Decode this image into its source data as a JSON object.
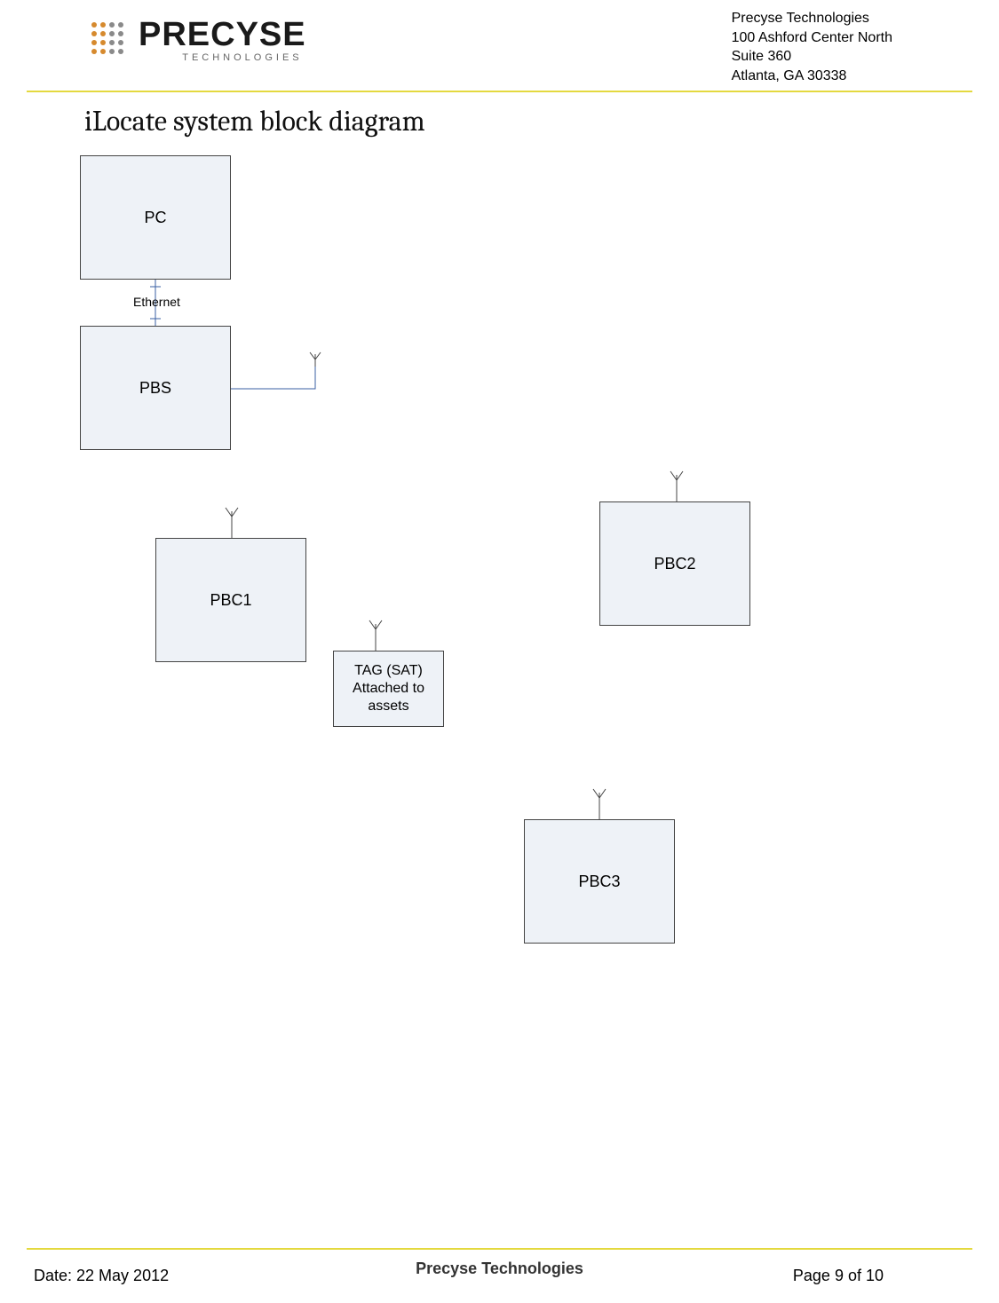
{
  "header": {
    "logo_main": "PRECYSE",
    "logo_sub": "TECHNOLOGIES",
    "address_line1": "Precyse Technologies",
    "address_line2": "100 Ashford Center North",
    "address_line3": "Suite 360",
    "address_line4": "Atlanta, GA  30338"
  },
  "title": "iLocate system block diagram",
  "diagram": {
    "blocks": {
      "pc": "PC",
      "pbs": "PBS",
      "pbc1": "PBC1",
      "pbc2": "PBC2",
      "pbc3": "PBC3",
      "tag": "TAG (SAT)\nAttached to\nassets"
    },
    "connectors": {
      "ethernet": "Ethernet"
    }
  },
  "footer": {
    "company": "Precyse Technologies",
    "date": "Date: 22 May 2012",
    "page": "Page 9 of 10"
  },
  "colors": {
    "block_fill": "#eef2f7",
    "accent": "#e4d93f",
    "logo_orange": "#d68a2e",
    "logo_grey": "#8a8a8a"
  }
}
